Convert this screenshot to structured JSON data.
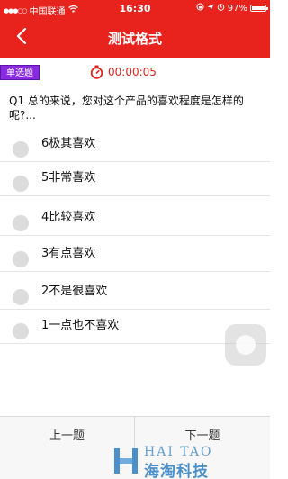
{
  "status_bar": {
    "signal": "●●●○○",
    "carrier": "中国联通",
    "wifi": "wifi-icon",
    "time": "16:30",
    "battery": "97%",
    "battery_level": 0.97
  },
  "nav": {
    "back_icon": "chevron-left-icon",
    "title": "测试格式"
  },
  "question_meta": {
    "type_badge": "单选题",
    "timer_icon": "stopwatch-icon",
    "timer": "00:00:05"
  },
  "question": {
    "text": "Q1 总的来说，您对这个产品的喜欢程度是怎样的呢?..."
  },
  "options": [
    {
      "label": "6极其喜欢"
    },
    {
      "label": "5非常喜欢"
    },
    {
      "label": "4比较喜欢"
    },
    {
      "label": "3有点喜欢"
    },
    {
      "label": "2不是很喜欢"
    },
    {
      "label": "1一点也不喜欢"
    }
  ],
  "footer": {
    "prev_label": "上一题",
    "next_label": "下一题"
  },
  "watermark": {
    "en": "HAI TAO",
    "cn": "海淘科技"
  },
  "colors": {
    "brand_red": "#e8231e",
    "badge_purple": "#8a2be2"
  }
}
